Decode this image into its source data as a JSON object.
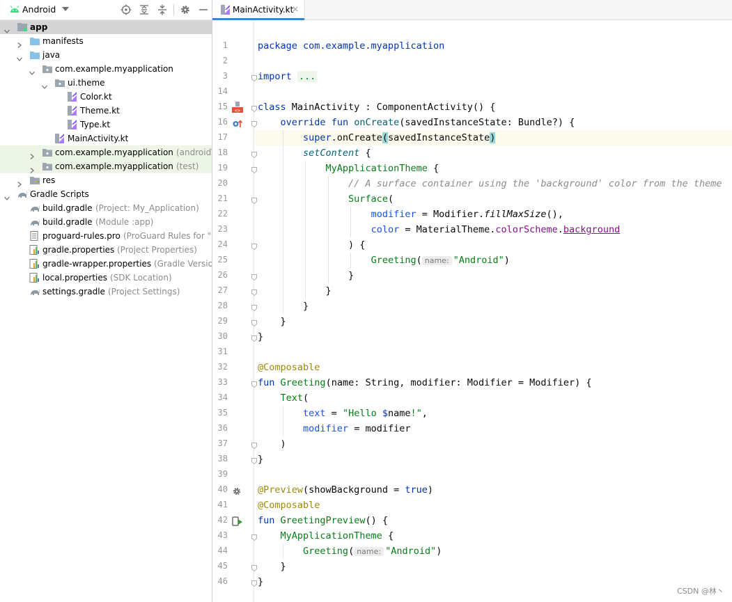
{
  "project_panel": {
    "view_label": "Android",
    "tree": [
      {
        "label": "app",
        "hint": "",
        "icon": "module",
        "arrow": "down"
      },
      {
        "label": "manifests",
        "hint": "",
        "icon": "folder",
        "arrow": "right"
      },
      {
        "label": "java",
        "hint": "",
        "icon": "folder",
        "arrow": "down"
      },
      {
        "label": "com.example.myapplication",
        "hint": "",
        "icon": "package",
        "arrow": "down"
      },
      {
        "label": "ui.theme",
        "hint": "",
        "icon": "package",
        "arrow": "down"
      },
      {
        "label": "Color.kt",
        "hint": "",
        "icon": "kotlin-file",
        "arrow": ""
      },
      {
        "label": "Theme.kt",
        "hint": "",
        "icon": "kotlin-file",
        "arrow": ""
      },
      {
        "label": "Type.kt",
        "hint": "",
        "icon": "kotlin-file",
        "arrow": ""
      },
      {
        "label": "MainActivity.kt",
        "hint": "",
        "icon": "kotlin-class",
        "arrow": ""
      },
      {
        "label": "com.example.myapplication",
        "hint": "(androidTest)",
        "icon": "package",
        "arrow": "right"
      },
      {
        "label": "com.example.myapplication",
        "hint": "(test)",
        "icon": "package",
        "arrow": "right"
      },
      {
        "label": "res",
        "hint": "",
        "icon": "res-folder",
        "arrow": "right"
      },
      {
        "label": "Gradle Scripts",
        "hint": "",
        "icon": "gradle",
        "arrow": "down"
      },
      {
        "label": "build.gradle",
        "hint": "(Project: My_Application)",
        "icon": "gradle",
        "arrow": ""
      },
      {
        "label": "build.gradle",
        "hint": "(Module :app)",
        "icon": "gradle",
        "arrow": ""
      },
      {
        "label": "proguard-rules.pro",
        "hint": "(ProGuard Rules for \":app\")",
        "icon": "text-file",
        "arrow": ""
      },
      {
        "label": "gradle.properties",
        "hint": "(Project Properties)",
        "icon": "properties",
        "arrow": ""
      },
      {
        "label": "gradle-wrapper.properties",
        "hint": "(Gradle Version)",
        "icon": "properties",
        "arrow": ""
      },
      {
        "label": "local.properties",
        "hint": "(SDK Location)",
        "icon": "properties",
        "arrow": ""
      },
      {
        "label": "settings.gradle",
        "hint": "(Project Settings)",
        "icon": "gradle",
        "arrow": ""
      }
    ]
  },
  "editor": {
    "tab_label": "MainActivity.kt",
    "tab_close": "×",
    "line_numbers": [
      "1",
      "2",
      "3",
      "14",
      "15",
      "16",
      "17",
      "18",
      "19",
      "20",
      "21",
      "22",
      "23",
      "24",
      "25",
      "26",
      "27",
      "28",
      "29",
      "30",
      "31",
      "32",
      "33",
      "34",
      "35",
      "36",
      "37",
      "38",
      "39",
      "40",
      "41",
      "42",
      "43",
      "44",
      "45",
      "46"
    ],
    "code": [
      [
        "package com.example.myapplication"
      ],
      [],
      [
        "import ",
        "..."
      ],
      [],
      [
        "class",
        " MainActivity : ComponentActivity() {"
      ],
      [
        "override",
        " ",
        "fun",
        " ",
        "onCreate",
        "(savedInstanceState: Bundle?) {"
      ],
      [
        "super",
        ".onCreate",
        "(",
        "savedInstanceState",
        ")"
      ],
      [
        "setContent",
        " {"
      ],
      [
        "MyApplicationTheme",
        " {"
      ],
      [
        "// A surface container using the 'background' color from the theme"
      ],
      [
        "Surface",
        "("
      ],
      [
        "modifier",
        " = Modifier.",
        "fillMaxSize",
        "(),"
      ],
      [
        "color",
        " = MaterialTheme.",
        "colorScheme",
        ".",
        "background"
      ],
      [
        ") {"
      ],
      [
        "Greeting",
        "(",
        "name:",
        "\"Android\"",
        ")"
      ],
      [
        "}"
      ],
      [
        "}"
      ],
      [
        "}"
      ],
      [
        "}"
      ],
      [
        "}"
      ],
      [],
      [
        "@Composable"
      ],
      [
        "fun",
        " ",
        "Greeting",
        "(name: String, modifier: Modifier = Modifier) {"
      ],
      [
        "Text",
        "("
      ],
      [
        "text",
        " = ",
        "\"Hello ",
        "$",
        "name",
        "!\"",
        ","
      ],
      [
        "modifier",
        " = modifier"
      ],
      [
        ")"
      ],
      [
        "}"
      ],
      [],
      [
        "@Preview",
        "(showBackground = ",
        "true",
        ")"
      ],
      [
        "@Composable"
      ],
      [
        "fun",
        " ",
        "GreetingPreview",
        "() {"
      ],
      [
        "MyApplicationTheme",
        " {"
      ],
      [
        "Greeting",
        "(",
        "name:",
        "\"Android\"",
        ")"
      ],
      [
        "}"
      ],
      [
        "}"
      ]
    ]
  },
  "watermark": "CSDN @林丶"
}
